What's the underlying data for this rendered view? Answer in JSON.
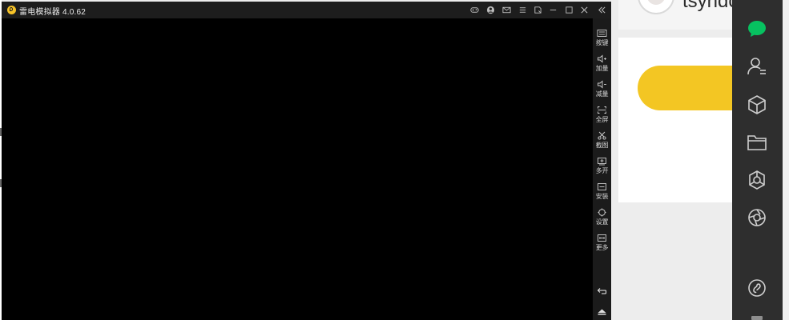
{
  "emulator": {
    "title": "雷电模拟器 4.0.62",
    "titlebar_icons": [
      "gamepad-icon",
      "user-icon",
      "mail-icon",
      "menu-icon",
      "screen-rotate-icon",
      "minimize-icon",
      "maximize-icon",
      "close-icon",
      "collapse-toolbar-icon"
    ],
    "toolbar": [
      {
        "label": "按键",
        "icon": "keyboard-icon"
      },
      {
        "label": "加量",
        "icon": "volume-up-icon"
      },
      {
        "label": "减量",
        "icon": "volume-down-icon"
      },
      {
        "label": "全屏",
        "icon": "fullscreen-icon"
      },
      {
        "label": "截图",
        "icon": "scissors-icon"
      },
      {
        "label": "多开",
        "icon": "multi-instance-icon"
      },
      {
        "label": "安装",
        "icon": "apk-install-icon"
      },
      {
        "label": "设置",
        "icon": "settings-icon"
      },
      {
        "label": "更多",
        "icon": "more-icon"
      }
    ],
    "bottom_icons": [
      "back-icon",
      "home-icon"
    ]
  },
  "background_app": {
    "username": "tsyndo",
    "accent_color": "#f3c623",
    "sidebar_icons": [
      "chat-icon",
      "contacts-icon",
      "cube-icon",
      "folder-icon",
      "moments-icon",
      "aperture-icon",
      "miniprogram-icon"
    ],
    "chat_icon_color": "#07c160"
  }
}
